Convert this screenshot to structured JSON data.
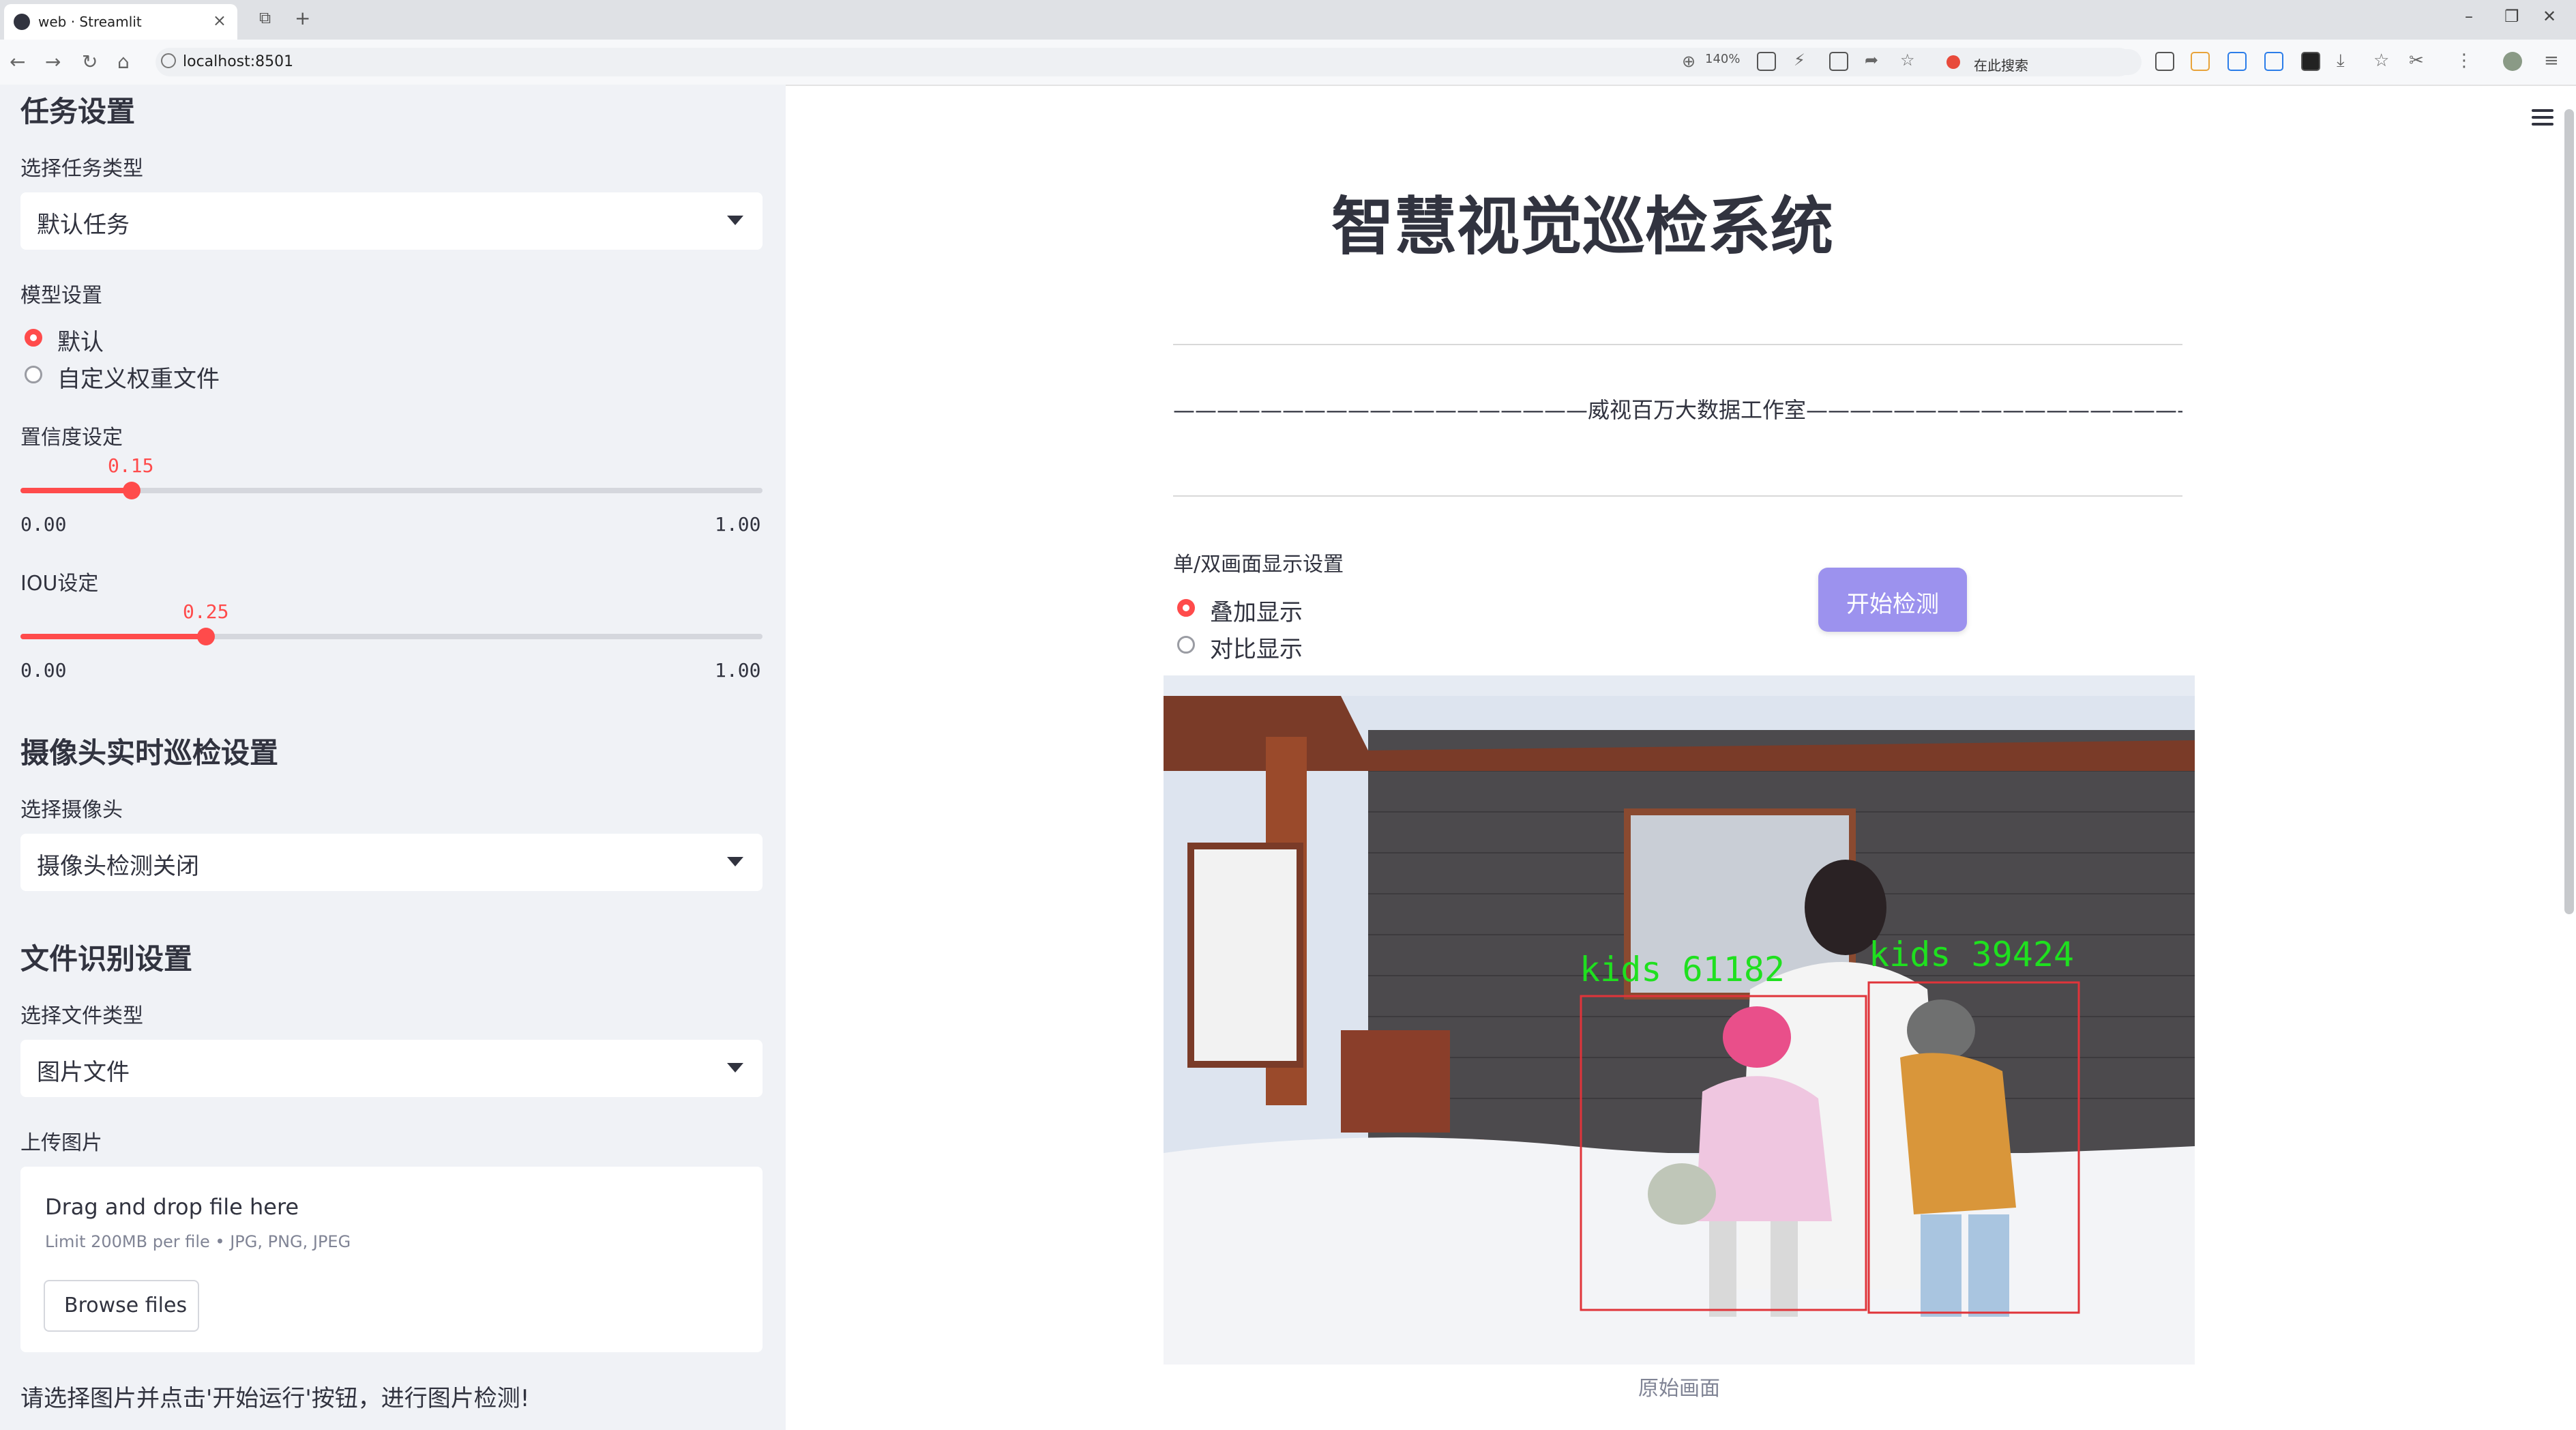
{
  "browser": {
    "tab_title": "web · Streamlit",
    "url": "localhost:8501",
    "zoom": "140%",
    "search_placeholder": "在此搜索"
  },
  "sidebar": {
    "task_header": "任务设置",
    "task_type_label": "选择任务类型",
    "task_type_value": "默认任务",
    "model_label": "模型设置",
    "model_options": [
      "默认",
      "自定义权重文件"
    ],
    "model_selected": 0,
    "confidence": {
      "label": "置信度设定",
      "value": "0.15",
      "min": "0.00",
      "max": "1.00",
      "fraction": 0.15
    },
    "iou": {
      "label": "IOU设定",
      "value": "0.25",
      "min": "0.00",
      "max": "1.00",
      "fraction": 0.25
    },
    "camera_header": "摄像头实时巡检设置",
    "camera_label": "选择摄像头",
    "camera_value": "摄像头检测关闭",
    "file_header": "文件识别设置",
    "file_type_label": "选择文件类型",
    "file_type_value": "图片文件",
    "upload_label": "上传图片",
    "upload_drag": "Drag and drop file here",
    "upload_limit": "Limit 200MB per file • JPG, PNG, JPEG",
    "browse_label": "Browse files",
    "hint": "请选择图片并点击'开始运行'按钮，进行图片检测!"
  },
  "main": {
    "title": "智慧视觉巡检系统",
    "studio": "———————————————————威视百万大数据工作室————————————————————",
    "display_label": "单/双画面显示设置",
    "display_options": [
      "叠加显示",
      "对比显示"
    ],
    "display_selected": 0,
    "start_button": "开始检测",
    "caption": "原始画面",
    "detections": [
      {
        "label": "kids 61182"
      },
      {
        "label": "kids 39424"
      }
    ],
    "colors": {
      "accent": "#ff4b4b",
      "button": "#9c92ee",
      "box": "#e0343a",
      "label": "#1fe01f"
    }
  }
}
